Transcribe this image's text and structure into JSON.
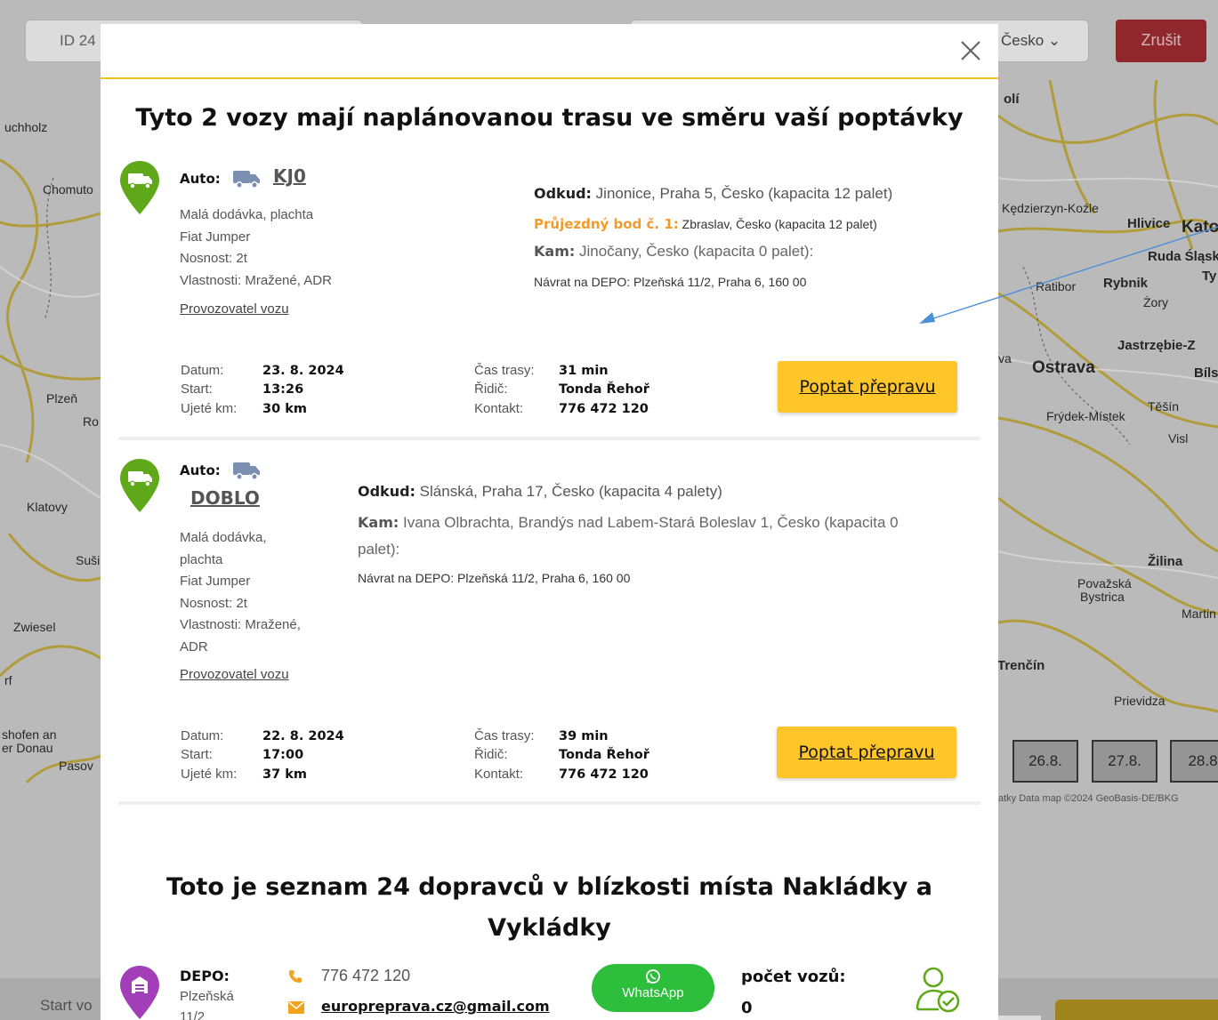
{
  "background": {
    "id_input_value": "ID 24",
    "country_value": "Česko",
    "cancel_label": "Zrušit",
    "start_label": "Start vo",
    "map_credit": "atky   Data map ©2024 GeoBasis-DE/BKG",
    "dates": [
      "26.8.",
      "27.8.",
      "28.8"
    ],
    "map_labels": [
      {
        "name": "uchholz",
        "style": ""
      },
      {
        "name": "Chomuto",
        "style": ""
      },
      {
        "name": "Plzeň",
        "style": ""
      },
      {
        "name": "Ro",
        "style": ""
      },
      {
        "name": "Klatovy",
        "style": ""
      },
      {
        "name": "Suši",
        "style": ""
      },
      {
        "name": "Zwiesel",
        "style": ""
      },
      {
        "name": "rf",
        "style": ""
      },
      {
        "name": "shofen an",
        "style": ""
      },
      {
        "name": "er Donau",
        "style": ""
      },
      {
        "name": "Pasov",
        "style": ""
      },
      {
        "name": "olí",
        "style": "bold"
      },
      {
        "name": "Kędzierzyn-Koźle",
        "style": ""
      },
      {
        "name": "Hlivice",
        "style": "bold"
      },
      {
        "name": "Kato",
        "style": "big"
      },
      {
        "name": "Ruda Śląsk",
        "style": "bold"
      },
      {
        "name": "Ty",
        "style": "bold"
      },
      {
        "name": "Ratibor",
        "style": ""
      },
      {
        "name": "Rybnik",
        "style": "bold"
      },
      {
        "name": "Żory",
        "style": ""
      },
      {
        "name": "Jastrzębie-Z",
        "style": "bold"
      },
      {
        "name": "Ostrava",
        "style": "big"
      },
      {
        "name": "Bíls",
        "style": "bold"
      },
      {
        "name": "Těšín",
        "style": ""
      },
      {
        "name": "Frýdek-Místek",
        "style": ""
      },
      {
        "name": "Visl",
        "style": ""
      },
      {
        "name": "Žilina",
        "style": "bold"
      },
      {
        "name": "Považská",
        "style": ""
      },
      {
        "name": "Bystrica",
        "style": ""
      },
      {
        "name": "Martin",
        "style": ""
      },
      {
        "name": "Trenčín",
        "style": "bold"
      },
      {
        "name": "Prievidza",
        "style": ""
      },
      {
        "name": "va",
        "style": ""
      }
    ]
  },
  "modal": {
    "title": "Tyto 2 vozy mají naplánovanou trasu ve směru vaší poptávky",
    "vehicles": [
      {
        "auto_label": "Auto:",
        "name": "KJ0",
        "specs": [
          "Malá dodávka, plachta",
          "Fiat Jumper",
          "Nosnost: 2t",
          "Vlastnosti: Mražené, ADR"
        ],
        "operator_link": "Provozovatel vozu",
        "from_label": "Odkud:",
        "from": "Jinonice, Praha 5, Česko (kapacita 12 palet)",
        "waypoint_label": "Průjezdný bod č. 1:",
        "waypoint": "Zbraslav, Česko (kapacita 12 palet)",
        "to_label": "Kam:",
        "to": "Jinočany, Česko (kapacita 0 palet):",
        "depot": "Návrat na DEPO: Plzeňská 11/2, Praha 6, 160 00",
        "date_label": "Datum:",
        "date": "23. 8. 2024",
        "start_label": "Start:",
        "start": "13:26",
        "km_label": "Ujeté km:",
        "km": "30 km",
        "time_label": "Čas trasy:",
        "time": "31 min",
        "driver_label": "Řidič:",
        "driver": "Tonda Řehoř",
        "contact_label": "Kontakt:",
        "contact": "776 472 120",
        "request_button": "Poptat přepravu"
      },
      {
        "auto_label": "Auto:",
        "name": "DOBLO",
        "specs": [
          "Malá dodávka,",
          "plachta",
          "Fiat Jumper",
          "Nosnost: 2t",
          "Vlastnosti: Mražené,",
          "ADR"
        ],
        "operator_link": "Provozovatel vozu",
        "from_label": "Odkud:",
        "from": "Slánská, Praha 17, Česko (kapacita 4 palety)",
        "to_label": "Kam:",
        "to": "Ivana Olbrachta, Brandýs nad Labem-Stará Boleslav 1, Česko (kapacita 0 palet):",
        "depot": "Návrat na DEPO: Plzeňská 11/2, Praha 6, 160 00",
        "date_label": "Datum:",
        "date": "22. 8. 2024",
        "start_label": "Start:",
        "start": "17:00",
        "km_label": "Ujeté km:",
        "km": "37 km",
        "time_label": "Čas trasy:",
        "time": "39 min",
        "driver_label": "Řidič:",
        "driver": "Tonda Řehoř",
        "contact_label": "Kontakt:",
        "contact": "776 472 120",
        "request_button": "Poptat přepravu"
      }
    ],
    "carriers_title": "Toto je seznam 24 dopravců v blízkosti místa Nakládky a Vykládky",
    "carrier": {
      "depot_label": "DEPO:",
      "address_line1": "Plzeňská",
      "address_line2": "11/2",
      "phone": "776 472 120",
      "email": "europreprava.cz@gmail.com",
      "whatsapp_label": "WhatsApp",
      "vehicle_count_label": "počet vozů:",
      "vehicle_count": "0"
    }
  },
  "colors": {
    "accent_yellow": "#ffc629",
    "pin_green": "#5fa81a",
    "pin_purple": "#a23fb8",
    "waypoint_orange": "#f39a28",
    "whatsapp_green": "#2dbe3c",
    "cancel_red": "#a3232a"
  }
}
